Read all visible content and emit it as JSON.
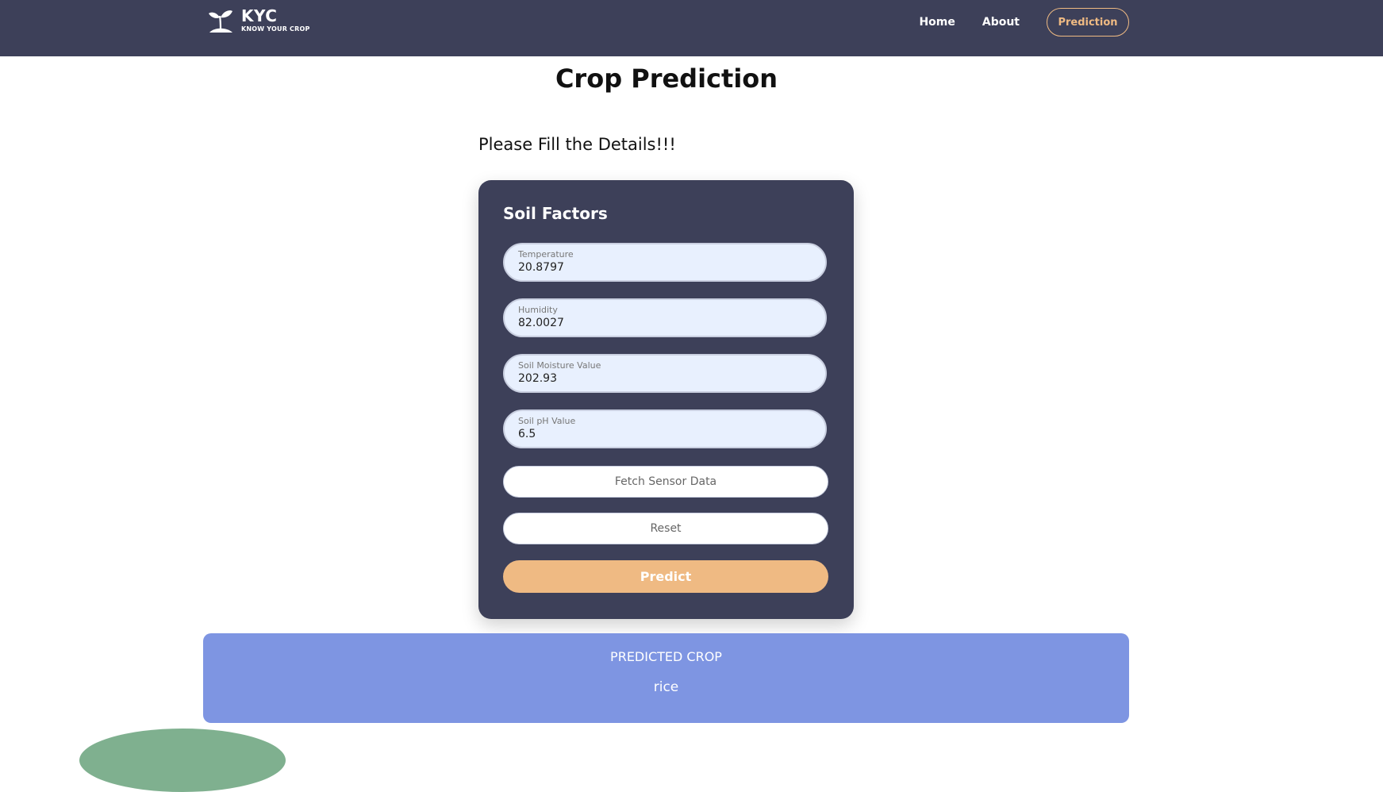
{
  "navbar": {
    "brand_title": "KYC",
    "brand_subtitle": "KNOW YOUR CROP",
    "links": {
      "home": "Home",
      "about": "About",
      "prediction": "Prediction"
    }
  },
  "page": {
    "title": "Crop Prediction",
    "subtitle": "Please Fill the Details!!!"
  },
  "form": {
    "section_title": "Soil Factors",
    "fields": {
      "temperature": {
        "label": "Temperature",
        "value": "20.8797"
      },
      "humidity": {
        "label": "Humidity",
        "value": "82.0027"
      },
      "soil_moisture": {
        "label": "Soil Moisture Value",
        "value": "202.93"
      },
      "soil_ph": {
        "label": "Soil pH Value",
        "value": "6.5"
      }
    },
    "buttons": {
      "fetch": "Fetch Sensor Data",
      "reset": "Reset",
      "predict": "Predict"
    }
  },
  "result": {
    "label": "PREDICTED CROP",
    "value": "rice"
  },
  "colors": {
    "navbar_bg": "#3d4059",
    "accent": "#efba83",
    "field_bg": "#e8f0fe",
    "result_bg": "#7e95e2",
    "decor": "#7fb08f"
  },
  "icons": {
    "brand_logo": "plant-sprout-icon"
  }
}
